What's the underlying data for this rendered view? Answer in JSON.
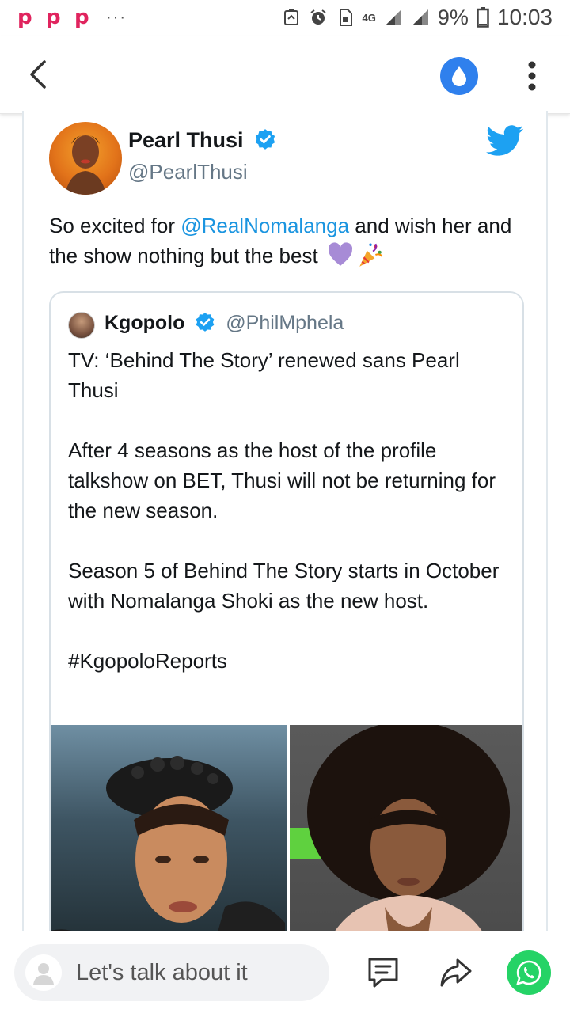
{
  "status_bar": {
    "app_icons": [
      "p-app-icon",
      "p-app-icon",
      "p-app-icon"
    ],
    "app_letter": "p",
    "more_dots": "···",
    "network": "4G",
    "battery": "9%",
    "time": "10:03"
  },
  "toolbar": {
    "back_icon": "chevron-left-icon",
    "drop_icon": "water-drop-icon",
    "more_icon": "vertical-dots-icon"
  },
  "tweet": {
    "author_name": "Pearl Thusi",
    "author_handle": "@PearlThusi",
    "text_before": "So excited for ",
    "mention": "@RealNomalanga",
    "text_after": " and wish her and the show nothing but the best",
    "emojis": [
      "purple-heart-emoji",
      "party-popper-emoji"
    ],
    "quoted": {
      "author_name": "Kgopolo",
      "author_handle": "@PhilMphela",
      "paragraphs": [
        "TV: ‘Behind The Story’ renewed sans Pearl Thusi",
        "After 4 seasons as the host of the profile talkshow on BET, Thusi will not be returning for the new season.",
        "Season 5 of Behind The Story starts in October with Nomalanga Shoki as the new host.",
        "#KgopoloReports"
      ]
    }
  },
  "bottom_bar": {
    "comment_placeholder": "Let's talk about it",
    "comment_icon": "comment-icon",
    "share_icon": "share-icon",
    "whatsapp_icon": "whatsapp-icon"
  },
  "colors": {
    "mention": "#1b95e0",
    "verified": "#1da1f2",
    "drop_button": "#2f80ed",
    "whatsapp": "#25d366",
    "status_app": "#e0245e"
  }
}
